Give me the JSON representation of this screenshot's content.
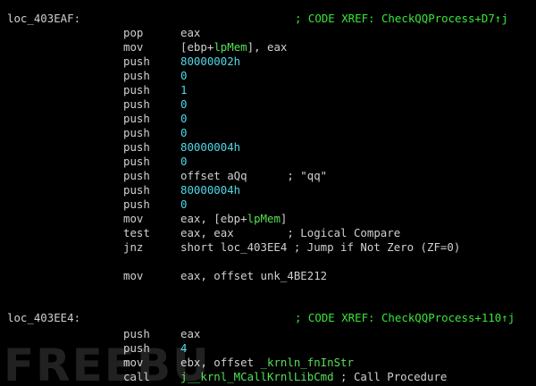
{
  "colors": {
    "background": "#000000",
    "text": "#d0d0d0",
    "xref": "#39e639",
    "number": "#4fd8e8",
    "name": "#56e056"
  },
  "blocks": [
    {
      "label": "loc_403EAF:",
      "xref": "; CODE XREF: CheckQQProcess+D7↑j",
      "lines": [
        {
          "mn": "pop",
          "ops": [
            {
              "t": "eax",
              "c": "plain"
            }
          ]
        },
        {
          "mn": "mov",
          "ops": [
            {
              "t": "[ebp+",
              "c": "plain"
            },
            {
              "t": "lpMem",
              "c": "name"
            },
            {
              "t": "], eax",
              "c": "plain"
            }
          ]
        },
        {
          "mn": "push",
          "ops": [
            {
              "t": "80000002h",
              "c": "num"
            }
          ]
        },
        {
          "mn": "push",
          "ops": [
            {
              "t": "0",
              "c": "num"
            }
          ]
        },
        {
          "mn": "push",
          "ops": [
            {
              "t": "1",
              "c": "num"
            }
          ]
        },
        {
          "mn": "push",
          "ops": [
            {
              "t": "0",
              "c": "num"
            }
          ]
        },
        {
          "mn": "push",
          "ops": [
            {
              "t": "0",
              "c": "num"
            }
          ]
        },
        {
          "mn": "push",
          "ops": [
            {
              "t": "0",
              "c": "num"
            }
          ]
        },
        {
          "mn": "push",
          "ops": [
            {
              "t": "80000004h",
              "c": "num"
            }
          ]
        },
        {
          "mn": "push",
          "ops": [
            {
              "t": "0",
              "c": "num"
            }
          ]
        },
        {
          "mn": "push",
          "ops": [
            {
              "t": "offset aQq      ; \"qq\"",
              "c": "plain"
            }
          ]
        },
        {
          "mn": "push",
          "ops": [
            {
              "t": "80000004h",
              "c": "num"
            }
          ]
        },
        {
          "mn": "push",
          "ops": [
            {
              "t": "0",
              "c": "num"
            }
          ]
        },
        {
          "mn": "mov",
          "ops": [
            {
              "t": "eax, [ebp+",
              "c": "plain"
            },
            {
              "t": "lpMem",
              "c": "name"
            },
            {
              "t": "]",
              "c": "plain"
            }
          ]
        },
        {
          "mn": "test",
          "ops": [
            {
              "t": "eax, eax        ; Logical Compare",
              "c": "plain"
            }
          ]
        },
        {
          "mn": "jnz",
          "ops": [
            {
              "t": "short loc_403EE4 ; Jump if Not Zero (ZF=0)",
              "c": "plain"
            }
          ]
        },
        {
          "mn": "",
          "ops": []
        },
        {
          "mn": "mov",
          "ops": [
            {
              "t": "eax, offset unk_4BE212",
              "c": "plain"
            }
          ]
        }
      ]
    },
    {
      "label": "loc_403EE4:",
      "xref": "; CODE XREF: CheckQQProcess+110↑j",
      "lines": [
        {
          "mn": "push",
          "ops": [
            {
              "t": "eax",
              "c": "plain"
            }
          ]
        },
        {
          "mn": "push",
          "ops": [
            {
              "t": "4",
              "c": "num"
            }
          ]
        },
        {
          "mn": "mov",
          "ops": [
            {
              "t": "ebx, offset ",
              "c": "plain"
            },
            {
              "t": "_krnln_fnInStr",
              "c": "name"
            }
          ]
        },
        {
          "mn": "call",
          "ops": [
            {
              "t": "j__krnl_MCallKrnlLibCmd",
              "c": "name"
            },
            {
              "t": " ; Call Procedure",
              "c": "plain"
            }
          ]
        }
      ]
    }
  ],
  "watermark": {
    "text": "FREEBUF"
  }
}
